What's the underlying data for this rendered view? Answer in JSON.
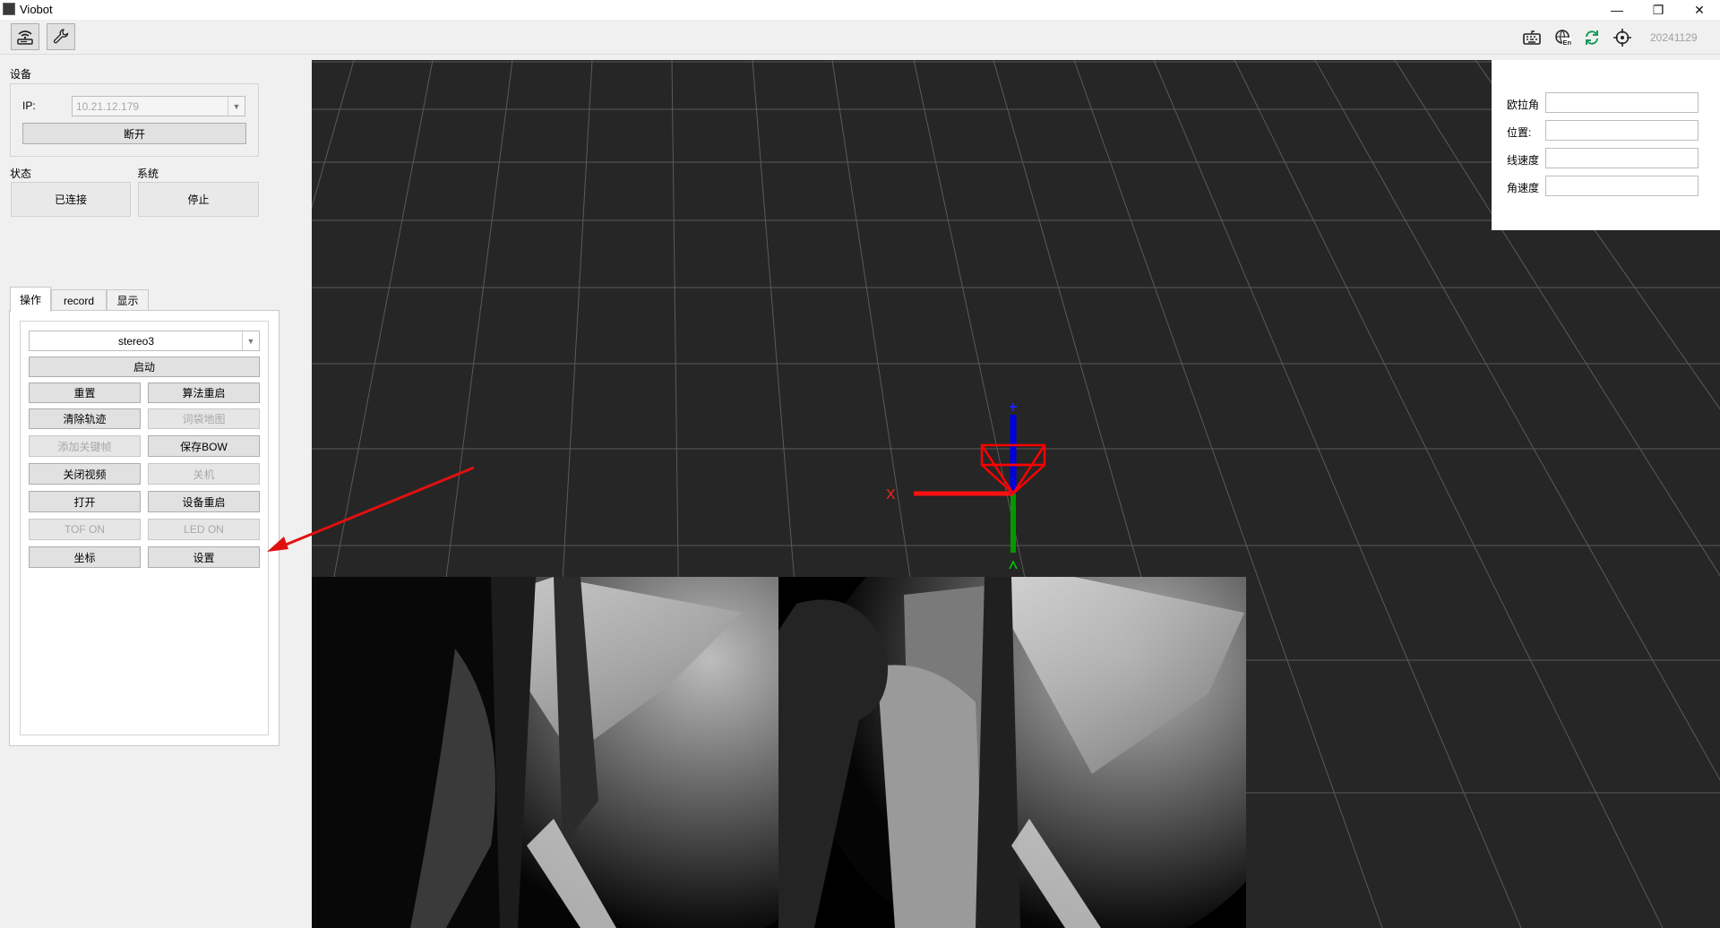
{
  "window": {
    "title": "Viobot",
    "minimize": "—",
    "restore": "❐",
    "close": "✕"
  },
  "toolbar": {
    "left_buttons": [
      {
        "icon": "wifi-router-icon"
      },
      {
        "icon": "wrench-icon"
      }
    ],
    "right_icons": [
      "keyboard-icon",
      "language-en-icon",
      "refresh-icon",
      "crosshair-icon"
    ],
    "version": "20241129"
  },
  "device": {
    "section_label": "设备",
    "ip_label": "IP:",
    "ip_value": "10.21.12.179",
    "disconnect_label": "断开"
  },
  "status": {
    "state_label": "状态",
    "system_label": "系统",
    "state_value": "已连接",
    "system_value": "停止"
  },
  "tabs": [
    {
      "label": "操作",
      "active": true
    },
    {
      "label": "record",
      "active": false
    },
    {
      "label": "显示",
      "active": false
    }
  ],
  "operations": {
    "mode_select": "stereo3",
    "start_label": "启动",
    "buttons": [
      {
        "label": "重置",
        "enabled": true
      },
      {
        "label": "算法重启",
        "enabled": true
      },
      {
        "label": "清除轨迹",
        "enabled": true
      },
      {
        "label": "词袋地图",
        "enabled": false
      },
      {
        "label": "添加关键帧",
        "enabled": false
      },
      {
        "label": "保存BOW",
        "enabled": true
      },
      {
        "label": "关闭视频",
        "enabled": true
      },
      {
        "label": "关机",
        "enabled": false
      },
      {
        "label": "打开",
        "enabled": true
      },
      {
        "label": "设备重启",
        "enabled": true
      },
      {
        "label": "TOF ON",
        "enabled": false
      },
      {
        "label": "LED ON",
        "enabled": false
      },
      {
        "label": "坐标",
        "enabled": true
      },
      {
        "label": "设置",
        "enabled": true
      }
    ]
  },
  "info": {
    "euler_label": "欧拉角",
    "position_label": "位置:",
    "linear_velocity_label": "线速度",
    "angular_velocity_label": "角速度",
    "euler_value": "",
    "position_value": "",
    "linear_velocity_value": "",
    "angular_velocity_value": ""
  },
  "viewport": {
    "x_axis_label": "X",
    "axis_colors": {
      "x": "#ff0000",
      "y": "#00aa00",
      "z": "#0000ff"
    }
  },
  "colors": {
    "annotation_arrow": "#e01010",
    "viewport_bg": "#262626",
    "grid": "#5a5a5a"
  }
}
